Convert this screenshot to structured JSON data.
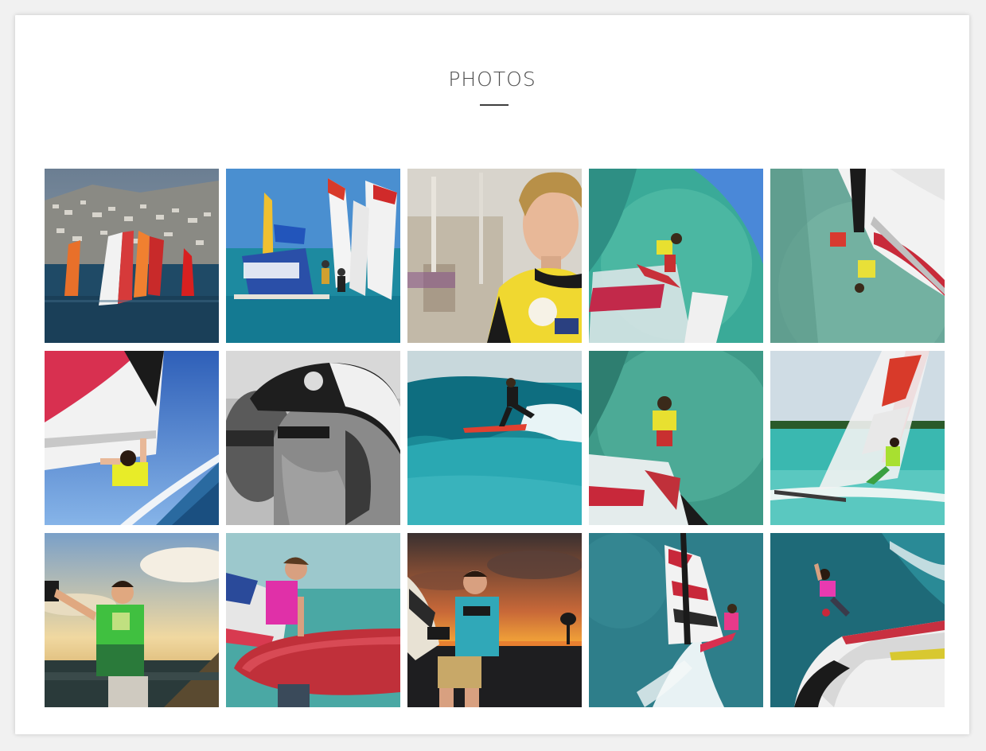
{
  "section": {
    "title": "PHOTOS"
  },
  "colors": {
    "page_background": "#f1f1f1",
    "card_background": "#ffffff",
    "title_text": "#4a4a4a",
    "underline": "#3e3e3e"
  },
  "gallery": {
    "columns": 5,
    "rows": 3,
    "items": [
      {
        "id": "windsurf-race-fleet-coast"
      },
      {
        "id": "windsurf-rene-egli-boat"
      },
      {
        "id": "portrait-rider-yellow-jersey"
      },
      {
        "id": "aerial-rider-turquoise-water"
      },
      {
        "id": "aerial-rider-sail-top-view"
      },
      {
        "id": "rider-low-angle-sky"
      },
      {
        "id": "bw-portrait-cap-sunglasses"
      },
      {
        "id": "surfing-wave"
      },
      {
        "id": "aerial-rider-yellow-shirt"
      },
      {
        "id": "windsurf-jump-beach"
      },
      {
        "id": "portrait-trophy-green-shirt-beach"
      },
      {
        "id": "rider-pink-shirt-red-board"
      },
      {
        "id": "portrait-trophy-sunset"
      },
      {
        "id": "aerial-rider-spray"
      },
      {
        "id": "rider-pink-top-view-sail"
      }
    ]
  }
}
